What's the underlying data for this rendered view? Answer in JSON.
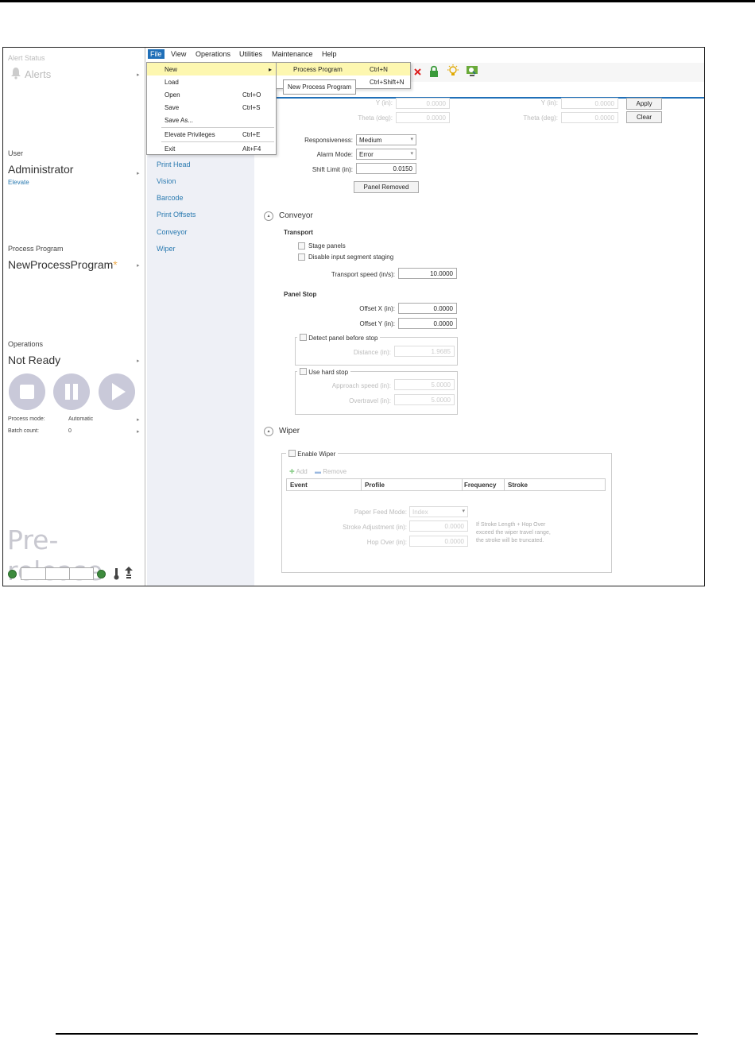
{
  "left_panel": {
    "alert_status_label": "Alert Status",
    "alerts_label": "Alerts",
    "user_label": "User",
    "user_name": "Administrator",
    "elevate_link": "Elevate",
    "process_program_label": "Process Program",
    "process_program_name": "NewProcessProgram",
    "process_program_modified_mark": "*",
    "operations_label": "Operations",
    "operations_status": "Not Ready",
    "process_mode_label": "Process mode:",
    "process_mode_value": "Automatic",
    "batch_count_label": "Batch count:",
    "batch_count_value": "0",
    "watermark": "Pre-release",
    "caret": "▸"
  },
  "menubar": {
    "items": [
      "File",
      "View",
      "Operations",
      "Utilities",
      "Maintenance",
      "Help"
    ]
  },
  "file_menu": {
    "items": [
      {
        "label": "New",
        "shortcut": "▸"
      },
      {
        "label": "Load",
        "shortcut": ""
      },
      {
        "label": "Open",
        "shortcut": "Ctrl+O"
      },
      {
        "label": "Save",
        "shortcut": "Ctrl+S"
      },
      {
        "label": "Save As...",
        "shortcut": ""
      },
      {
        "label": "Elevate Privileges",
        "shortcut": "Ctrl+E"
      },
      {
        "label": "Exit",
        "shortcut": "Alt+F4"
      }
    ]
  },
  "new_submenu": {
    "item_label": "Process Program",
    "item_shortcut": "Ctrl+N",
    "item2_shortcut": "Ctrl+Shift+N",
    "tooltip": "New Process Program"
  },
  "nav": {
    "items": [
      "Print Head",
      "Vision",
      "Barcode",
      "Print Offsets",
      "Conveyor",
      "Wiper"
    ]
  },
  "top_section": {
    "y_label_left": "Y (in):",
    "y_value_left": "0.0000",
    "theta_label_left": "Theta (deg):",
    "theta_value_left": "0.0000",
    "y_label_right": "Y (in):",
    "y_value_right": "0.0000",
    "theta_label_right": "Theta (deg):",
    "theta_value_right": "0.0000",
    "apply_button": "Apply",
    "clear_button": "Clear",
    "responsiveness_label": "Responsiveness:",
    "responsiveness_value": "Medium",
    "alarm_mode_label": "Alarm Mode:",
    "alarm_mode_value": "Error",
    "shift_limit_label": "Shift Limit (in):",
    "shift_limit_value": "0.0150",
    "panel_removed_button": "Panel Removed"
  },
  "conveyor": {
    "title": "Conveyor",
    "transport_header": "Transport",
    "stage_panels": "Stage panels",
    "disable_input": "Disable input segment staging",
    "transport_speed_label": "Transport speed (in/s):",
    "transport_speed_value": "10.0000",
    "panel_stop_header": "Panel Stop",
    "offset_x_label": "Offset X (in):",
    "offset_x_value": "0.0000",
    "offset_y_label": "Offset Y (in):",
    "offset_y_value": "0.0000",
    "detect_panel_label": "Detect panel before stop",
    "distance_label": "Distance (in):",
    "distance_value": "1.9685",
    "use_hard_stop_label": "Use hard stop",
    "approach_speed_label": "Approach speed (in):",
    "approach_speed_value": "5.0000",
    "overtravel_label": "Overtravel (in):",
    "overtravel_value": "5.0000"
  },
  "wiper": {
    "title": "Wiper",
    "enable_label": "Enable Wiper",
    "add_label": "Add",
    "remove_label": "Remove",
    "columns": [
      "Event",
      "Profile",
      "Frequency",
      "Stroke"
    ],
    "paper_feed_label": "Paper Feed Mode:",
    "paper_feed_value": "Index",
    "stroke_adj_label": "Stroke Adjustment (in):",
    "stroke_adj_value": "0.0000",
    "hop_over_label": "Hop Over (in):",
    "hop_over_value": "0.0000",
    "note_line1": "If Stroke Length + Hop Over",
    "note_line2": "exceed the wiper travel range,",
    "note_line3": "the stroke will be truncated."
  },
  "icons": {
    "toolbar": [
      "close-icon",
      "lock-icon",
      "lightbulb-icon",
      "search-monitor-icon"
    ],
    "section_toggle": "▴"
  },
  "colors": {
    "accent": "#1f6fb8",
    "link": "#2a7ab0",
    "status_green": "#3d8b3d",
    "control_gray": "#c9c9d9",
    "menu_highlight": "#fdf7b0"
  }
}
